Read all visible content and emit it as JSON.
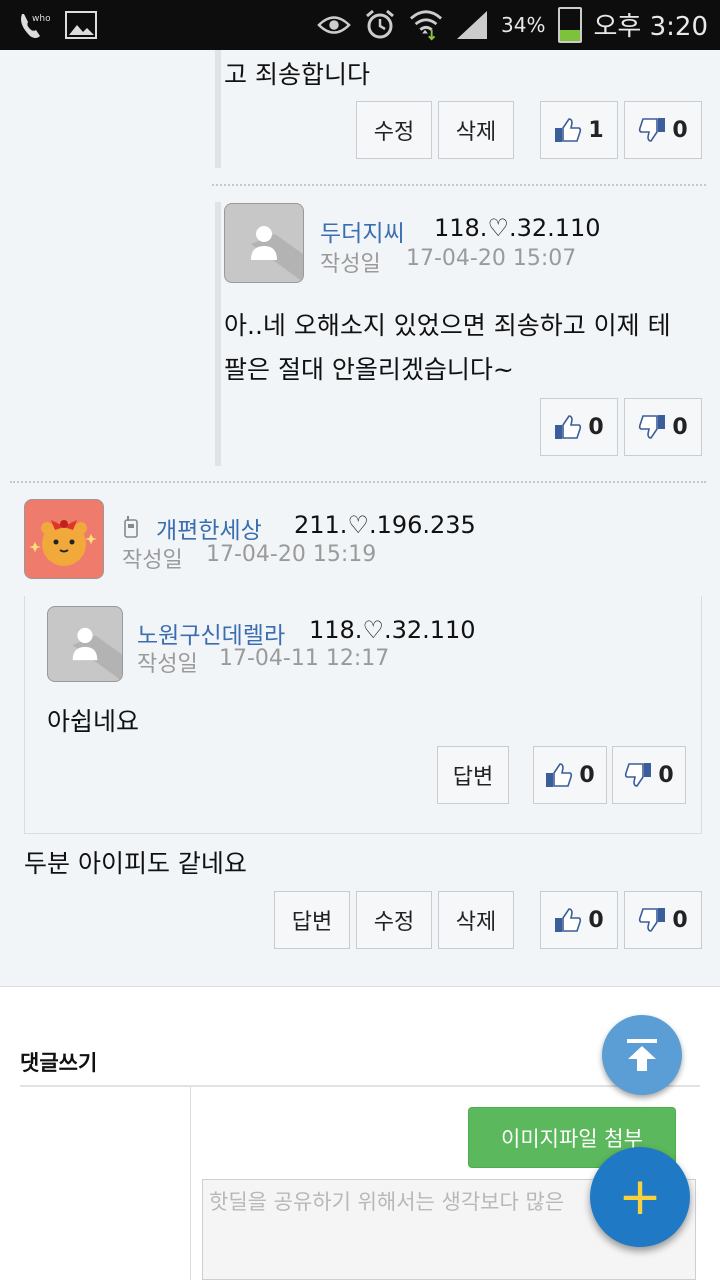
{
  "status_bar": {
    "battery_pct": "34%",
    "time": "오후 3:20",
    "icons": [
      "whowho-call-icon",
      "gallery-icon",
      "eye-icon",
      "alarm-icon",
      "wifi-icon",
      "signal-icon",
      "battery-icon"
    ]
  },
  "comments": {
    "top_tail": {
      "text": "고 죄송합니다",
      "edit_label": "수정",
      "delete_label": "삭제",
      "like_count": "1",
      "dislike_count": "0"
    },
    "reply1": {
      "author": "두더지씨",
      "ip": "118.♡.32.110",
      "date_label": "작성일",
      "date": "17-04-20 15:07",
      "line1": "아..네 오해소지 있었으면 죄송하고 이제 테",
      "line2": "팔은 절대 안올리겠습니다~",
      "like_count": "0",
      "dislike_count": "0"
    },
    "comment2": {
      "author": "개편한세상",
      "ip": "211.♡.196.235",
      "date_label": "작성일",
      "date": "17-04-20 15:19",
      "quote": {
        "author": "노원구신데렐라",
        "ip": "118.♡.32.110",
        "date_label": "작성일",
        "date": "17-04-11 12:17",
        "text": "아쉽네요",
        "reply_label": "답변",
        "like_count": "0",
        "dislike_count": "0"
      },
      "text": "두분 아이피도 같네요",
      "reply_label": "답변",
      "edit_label": "수정",
      "delete_label": "삭제",
      "like_count": "0",
      "dislike_count": "0"
    }
  },
  "write": {
    "title": "댓글쓰기",
    "attach_label": "이미지파일 첨부",
    "placeholder": "핫딜을 공유하기 위해서는 생각보다 많은"
  },
  "colors": {
    "accent": "#3a6eb0",
    "attach_green": "#5cb85c",
    "fab_blue": "#1f79c4"
  }
}
